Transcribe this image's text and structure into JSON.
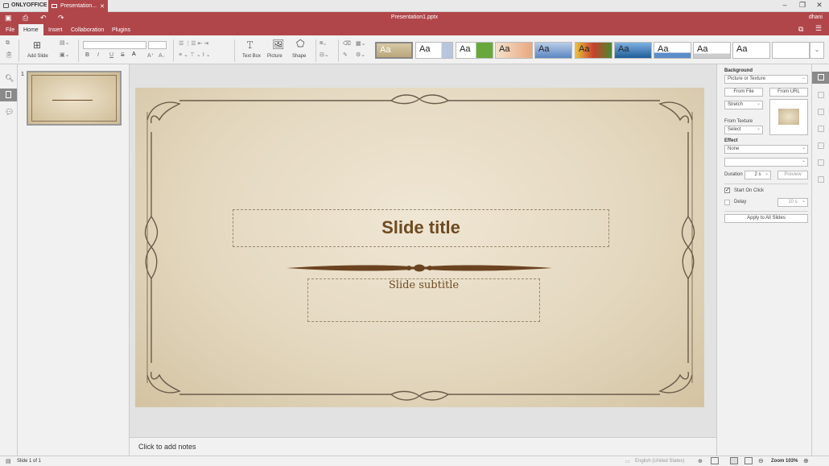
{
  "window": {
    "brand": "ONLYOFFICE",
    "tab_title": "Presentation...",
    "doc_title": "Presentation1.pptx",
    "user": "dhani"
  },
  "menu": {
    "tabs": [
      {
        "label": "File"
      },
      {
        "label": "Home"
      },
      {
        "label": "Insert"
      },
      {
        "label": "Collaboration"
      },
      {
        "label": "Plugins"
      }
    ]
  },
  "toolbar": {
    "add_slide": "Add Slide",
    "text_box": "Text Box",
    "picture": "Picture",
    "shape": "Shape",
    "themes": [
      "Aa",
      "Aa",
      "Aa",
      "Aa",
      "Aa",
      "Aa",
      "Aa",
      "Aa",
      "Aa",
      "Aa"
    ]
  },
  "thumbnails": {
    "slide_number": "1"
  },
  "slide": {
    "title": "Slide title",
    "subtitle": "Slide subtitle"
  },
  "notes": {
    "placeholder": "Click to add notes"
  },
  "right_panel": {
    "background_label": "Background",
    "fill_type": "Picture or Texture",
    "from_file": "From File",
    "from_url": "From URL",
    "stretch": "Stretch",
    "from_texture": "From Texture",
    "texture_select": "Select",
    "effect_label": "Effect",
    "effect_value": "None",
    "duration_label": "Duration",
    "duration_value": "2 s",
    "preview": "Preview",
    "start_on_click": "Start On Click",
    "delay_label": "Delay",
    "delay_value": "10 s",
    "apply_all": "Apply to All Slides"
  },
  "status": {
    "slide_counter": "Slide 1 of 1",
    "language": "English (United States)",
    "zoom": "Zoom 103%"
  },
  "colors": {
    "brand": "#b0464a",
    "slide_title": "#6e4a22"
  }
}
